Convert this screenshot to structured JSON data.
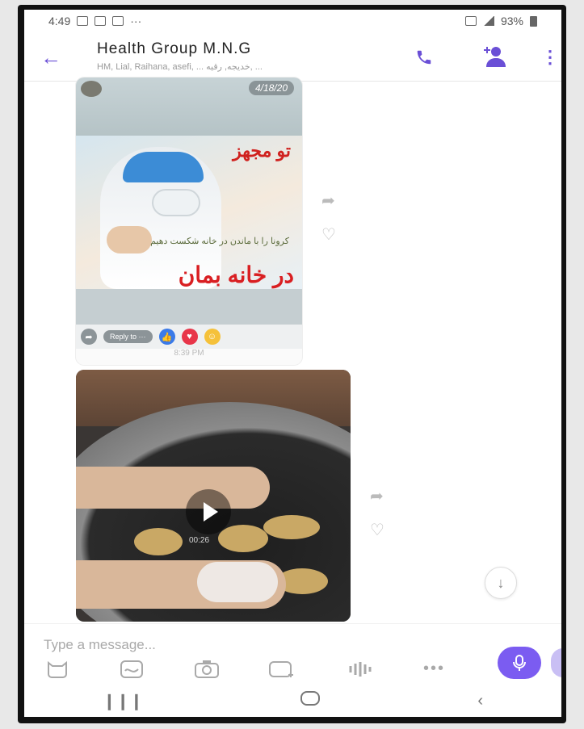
{
  "status_bar": {
    "time": "4:49",
    "dots": "···",
    "battery": "93%"
  },
  "header": {
    "back_icon": "arrow-left-icon",
    "title": "Health Group M.N.G",
    "subtitle": "HM, Lial, Raihana, asefi, ... خدیجه, رقیه, ...",
    "call_icon": "phone-icon",
    "add_member_icon": "add-person-icon",
    "more_icon": "more-vert-icon"
  },
  "messages": [
    {
      "date_badge": "4/18/20",
      "poster_top_text": "تو مجهز",
      "poster_mid_text": "کرونا را با ماندن در خانه شکست دهیم",
      "poster_big_text": "در خانه بمان",
      "reply_pill": "Reply to ···",
      "time": "8:39 PM"
    },
    {
      "type": "video",
      "duration": "00:26"
    }
  ],
  "composer": {
    "placeholder": "Type a message..."
  },
  "colors": {
    "accent": "#6a4fd6",
    "mic": "#7b5cf1"
  }
}
